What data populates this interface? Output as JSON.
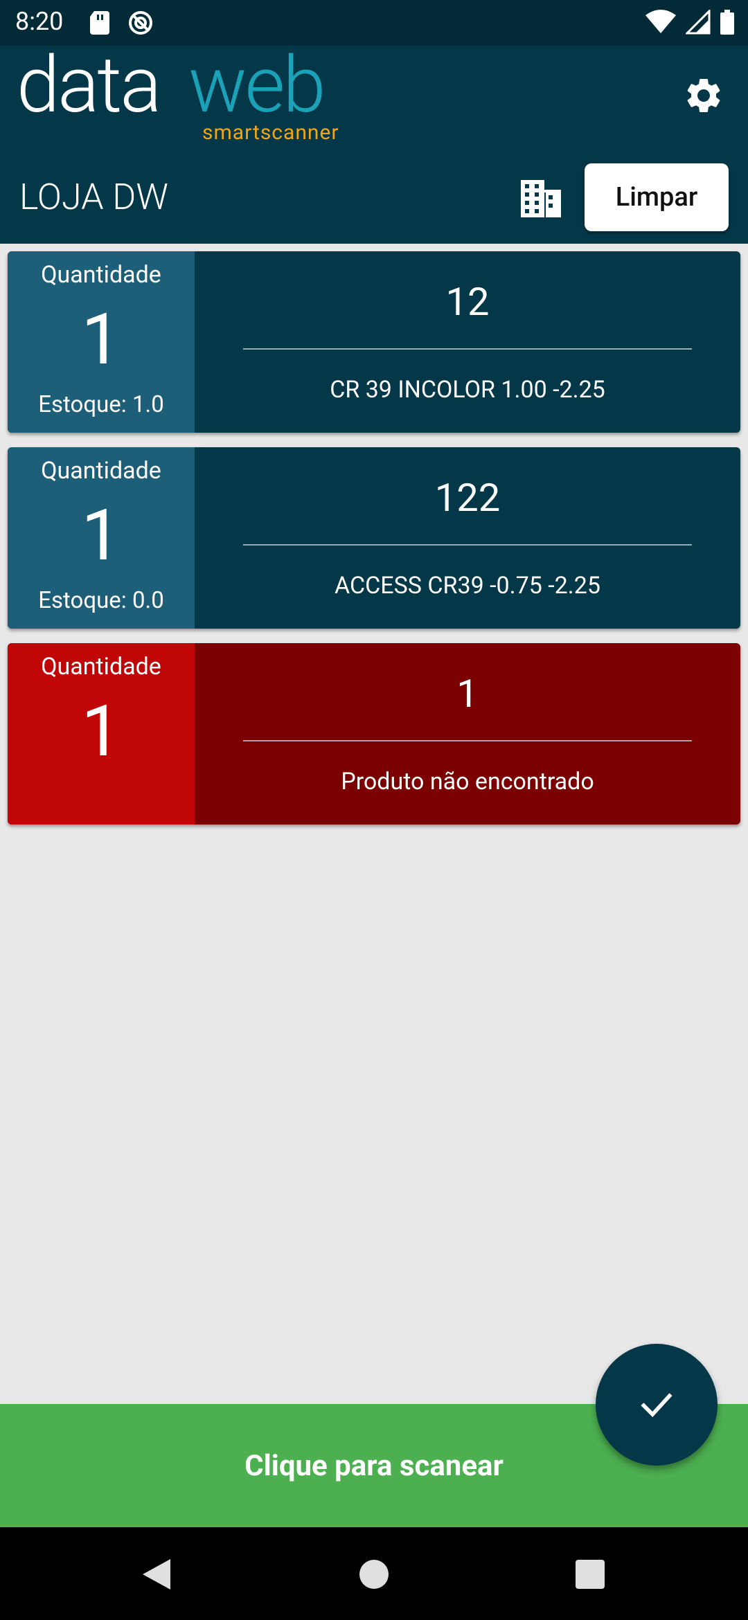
{
  "status_bar": {
    "time": "8:20"
  },
  "header": {
    "logo_primary": "data",
    "logo_secondary": "web",
    "logo_tagline": "smartscanner",
    "store_name": "LOJA DW",
    "clear_label": "Limpar"
  },
  "items": [
    {
      "quantity_label": "Quantidade",
      "quantity": "1",
      "stock": "Estoque: 1.0",
      "code": "12",
      "description": "CR 39 INCOLOR  1.00 -2.25",
      "status": "found"
    },
    {
      "quantity_label": "Quantidade",
      "quantity": "1",
      "stock": "Estoque: 0.0",
      "code": "122",
      "description": "ACCESS CR39 -0.75 -2.25",
      "status": "found"
    },
    {
      "quantity_label": "Quantidade",
      "quantity": "1",
      "stock": "",
      "code": "1",
      "description": "Produto não encontrado",
      "status": "not_found"
    }
  ],
  "scan_button_label": "Clique para scanear",
  "colors": {
    "app_bar": "#043748",
    "qty_panel": "#1d5e78",
    "error_card": "#7b0000",
    "error_qty": "#c00606",
    "scan_bar": "#4caf50",
    "logo_accent": "#1aa3b8",
    "tagline": "#f2a516"
  },
  "icons": {
    "settings": "gear-icon",
    "store_select": "building-icon",
    "confirm": "check-icon"
  }
}
